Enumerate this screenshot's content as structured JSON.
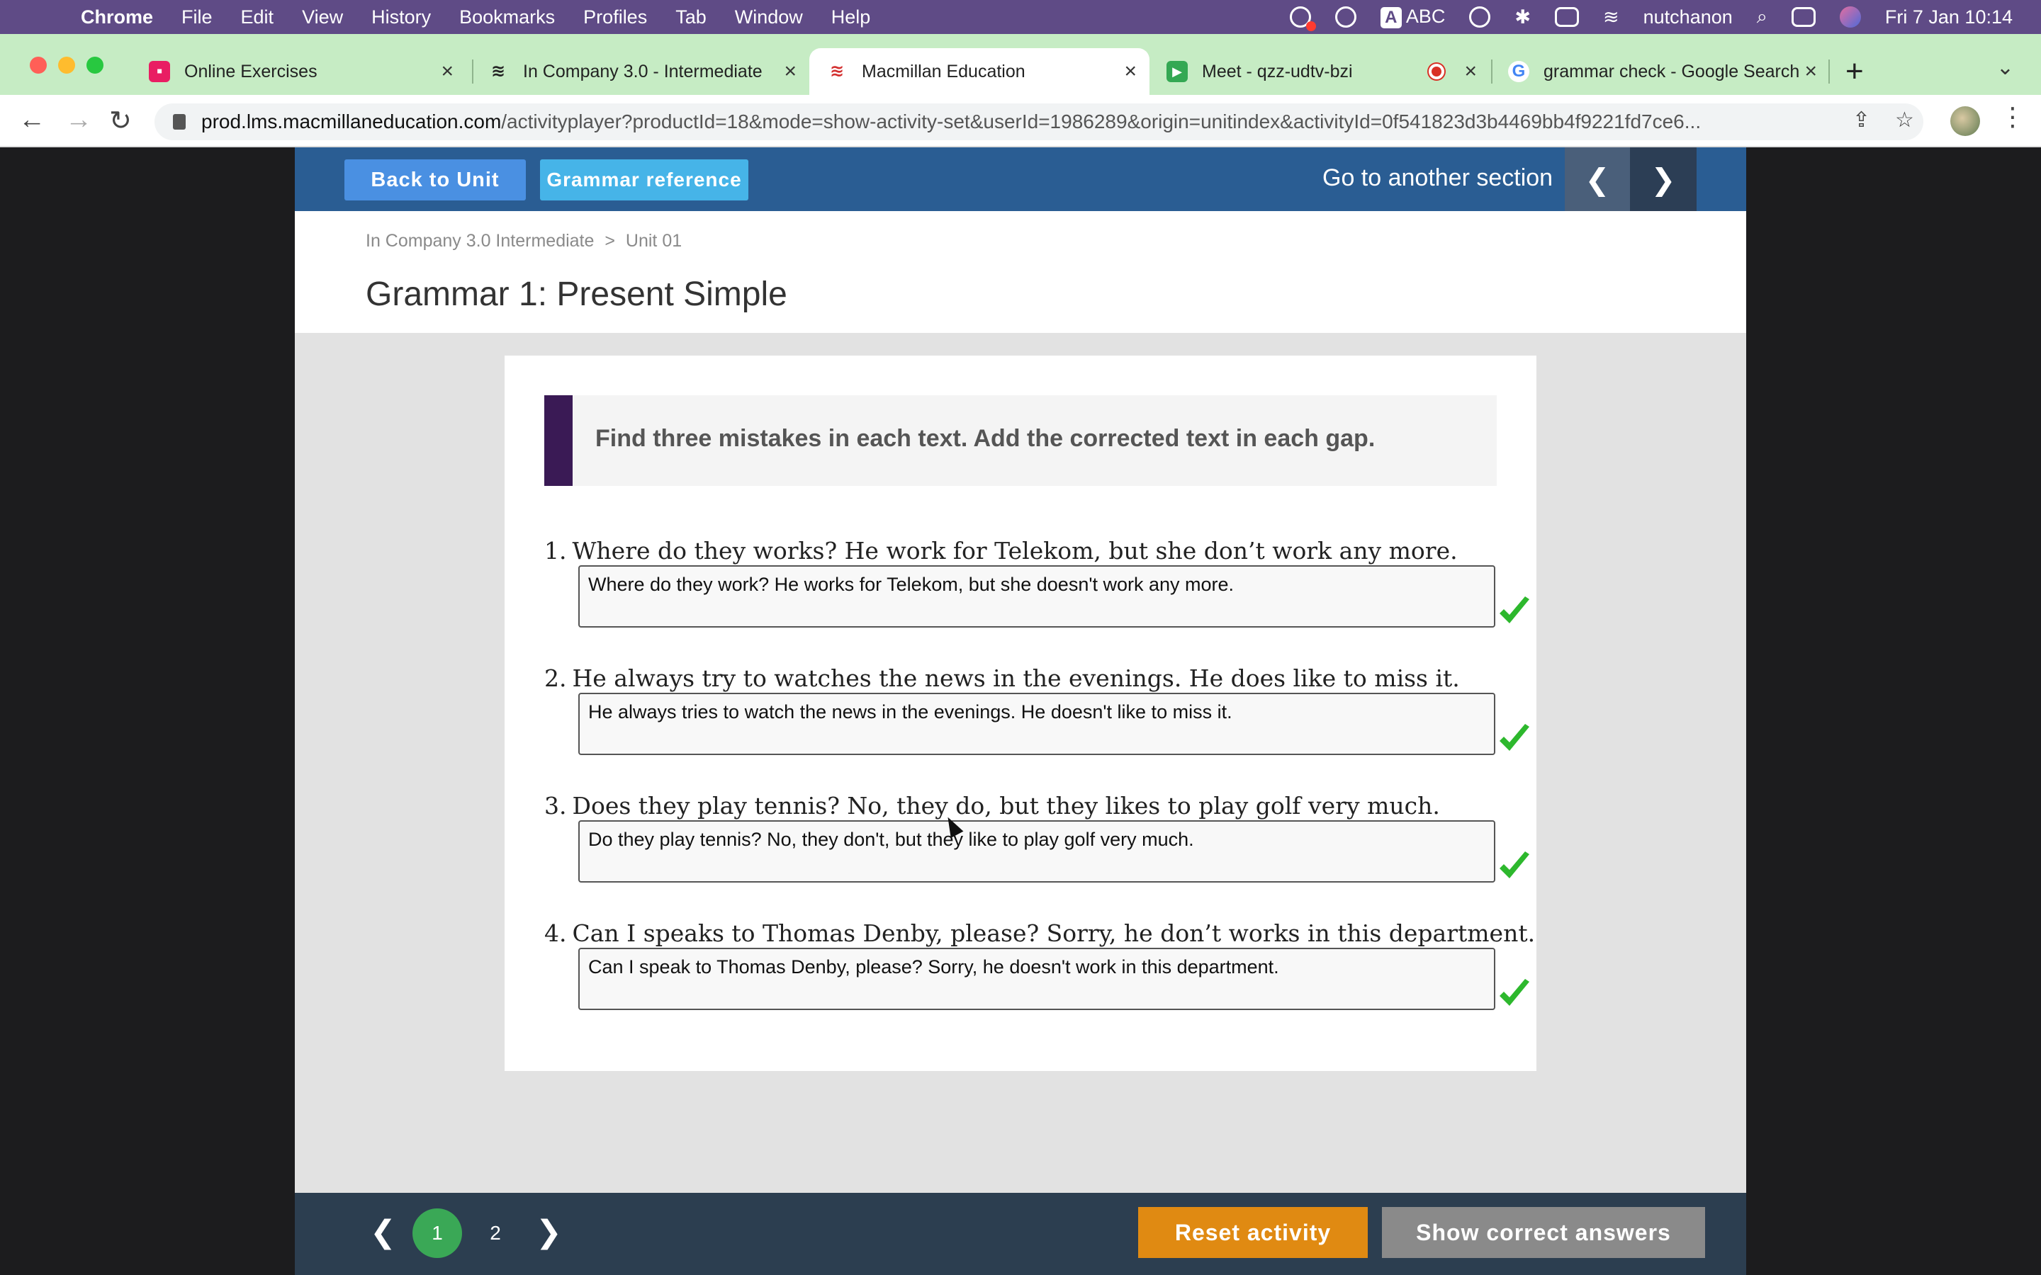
{
  "menubar": {
    "app_name": "Chrome",
    "items": [
      "File",
      "Edit",
      "View",
      "History",
      "Bookmarks",
      "Profiles",
      "Tab",
      "Window",
      "Help"
    ],
    "input_source": "ABC",
    "user": "nutchanon",
    "datetime": "Fri 7 Jan  10:14"
  },
  "tabs": [
    {
      "title": "Online Exercises",
      "icon": "classroom-icon",
      "color": "#e91e63"
    },
    {
      "title": "In Company 3.0 - Intermediate",
      "icon": "macmillan-icon",
      "color": "#222222"
    },
    {
      "title": "Macmillan Education",
      "icon": "macmillan-icon",
      "color": "#d32f2f",
      "active": true
    },
    {
      "title": "Meet - qzz-udtv-bzi",
      "icon": "meet-icon",
      "color": "#34a853",
      "recording": true
    },
    {
      "title": "grammar check - Google Search",
      "icon": "google-icon",
      "color": "#4285f4"
    }
  ],
  "address_bar": {
    "host": "prod.lms.macmillaneducation.com",
    "path": "/activityplayer?productId=18&mode=show-activity-set&userId=1986289&origin=unitindex&activityId=0f541823d3b4469bb4f9221fd7ce6..."
  },
  "topbar": {
    "back_label": "Back to Unit",
    "grammar_label": "Grammar reference",
    "goto_label": "Go to another section",
    "prev_symbol": "❮",
    "next_symbol": "❯"
  },
  "breadcrumb": {
    "course": "In Company 3.0 Intermediate",
    "separator": ">",
    "unit": "Unit 01"
  },
  "page_title": "Grammar 1: Present Simple",
  "instructions": "Find three mistakes in each text. Add the corrected text in each gap.",
  "questions": [
    {
      "num": "1.",
      "text": "Where do they works? He work for Telekom, but she don’t work any more.",
      "answer": "Where do they work? He works for Telekom, but she doesn't work any more.",
      "correct": true
    },
    {
      "num": "2.",
      "text": "He always try to watches the news in the evenings. He does like to miss it.",
      "answer": "He always tries to watch the news in the evenings. He doesn't like to miss it.",
      "correct": true
    },
    {
      "num": "3.",
      "text": "Does they play tennis? No, they do, but they likes to play golf very much.",
      "answer": "Do they play tennis? No, they don't, but they like to play golf very much.",
      "correct": true
    },
    {
      "num": "4.",
      "text": "Can I speaks to Thomas Denby, please? Sorry, he don’t works in this department.",
      "answer": "Can I speak to Thomas Denby, please? Sorry, he doesn't work in this department.",
      "correct": true
    }
  ],
  "footer": {
    "prev_symbol": "❮",
    "pages": [
      "1",
      "2"
    ],
    "current_page": "1",
    "next_symbol": "❯",
    "reset_label": "Reset activity",
    "show_answers_label": "Show correct answers"
  },
  "colors": {
    "topbar": "#2a5d93",
    "footer": "#2c3e50",
    "reset": "#e08a12",
    "check": "#2db82d",
    "instruction_bar": "#3a1a55"
  }
}
